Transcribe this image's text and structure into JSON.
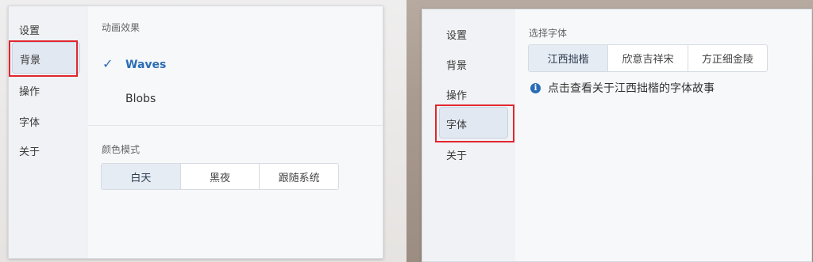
{
  "left": {
    "nav": [
      "设置",
      "背景",
      "操作",
      "字体",
      "关于"
    ],
    "selected_nav": "背景",
    "animation": {
      "title": "动画效果",
      "options": [
        "Waves",
        "Blobs"
      ],
      "selected": "Waves"
    },
    "color_mode": {
      "title": "颜色模式",
      "options": [
        "白天",
        "黑夜",
        "跟随系统"
      ],
      "selected": "白天"
    }
  },
  "right": {
    "nav": [
      "设置",
      "背景",
      "操作",
      "字体",
      "关于"
    ],
    "selected_nav": "字体",
    "font": {
      "title": "选择字体",
      "options": [
        "江西拙楷",
        "欣意吉祥宋",
        "方正细金陵"
      ],
      "selected": "江西拙楷"
    },
    "info_text": "点击查看关于江西拙楷的字体故事"
  },
  "colors": {
    "accent": "#2a6db6",
    "highlight": "#e2262e"
  },
  "icons": {
    "check": "check-icon",
    "info": "info-icon"
  }
}
